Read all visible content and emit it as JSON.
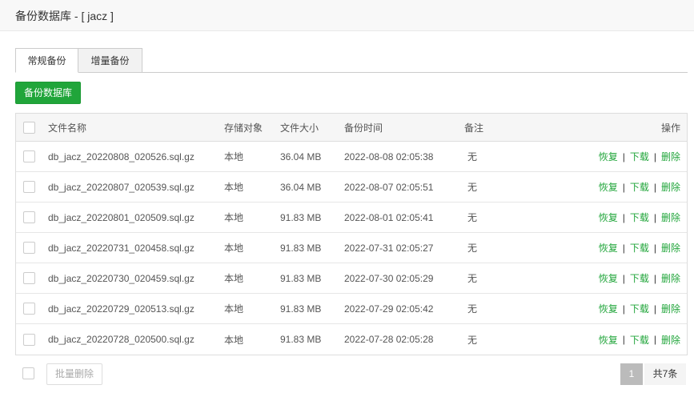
{
  "header": {
    "title": "备份数据库 - [ jacz ]"
  },
  "tabs": [
    {
      "label": "常规备份"
    },
    {
      "label": "增量备份"
    }
  ],
  "actions": {
    "backup_button": "备份数据库"
  },
  "table": {
    "columns": {
      "name": "文件名称",
      "target": "存储对象",
      "size": "文件大小",
      "time": "备份时间",
      "note": "备注",
      "ops": "操作"
    },
    "ops_labels": {
      "restore": "恢复",
      "download": "下载",
      "delete": "删除",
      "sep": "|"
    },
    "rows": [
      {
        "name": "db_jacz_20220808_020526.sql.gz",
        "target": "本地",
        "size": "36.04 MB",
        "time": "2022-08-08 02:05:38",
        "note": "无"
      },
      {
        "name": "db_jacz_20220807_020539.sql.gz",
        "target": "本地",
        "size": "36.04 MB",
        "time": "2022-08-07 02:05:51",
        "note": "无"
      },
      {
        "name": "db_jacz_20220801_020509.sql.gz",
        "target": "本地",
        "size": "91.83 MB",
        "time": "2022-08-01 02:05:41",
        "note": "无"
      },
      {
        "name": "db_jacz_20220731_020458.sql.gz",
        "target": "本地",
        "size": "91.83 MB",
        "time": "2022-07-31 02:05:27",
        "note": "无"
      },
      {
        "name": "db_jacz_20220730_020459.sql.gz",
        "target": "本地",
        "size": "91.83 MB",
        "time": "2022-07-30 02:05:29",
        "note": "无"
      },
      {
        "name": "db_jacz_20220729_020513.sql.gz",
        "target": "本地",
        "size": "91.83 MB",
        "time": "2022-07-29 02:05:42",
        "note": "无"
      },
      {
        "name": "db_jacz_20220728_020500.sql.gz",
        "target": "本地",
        "size": "91.83 MB",
        "time": "2022-07-28 02:05:28",
        "note": "无"
      }
    ]
  },
  "footer": {
    "batch_delete": "批量删除",
    "page_current": "1",
    "page_total": "共7条"
  },
  "colors": {
    "accent": "#20a53a",
    "page_active": "#bbbbbb"
  }
}
